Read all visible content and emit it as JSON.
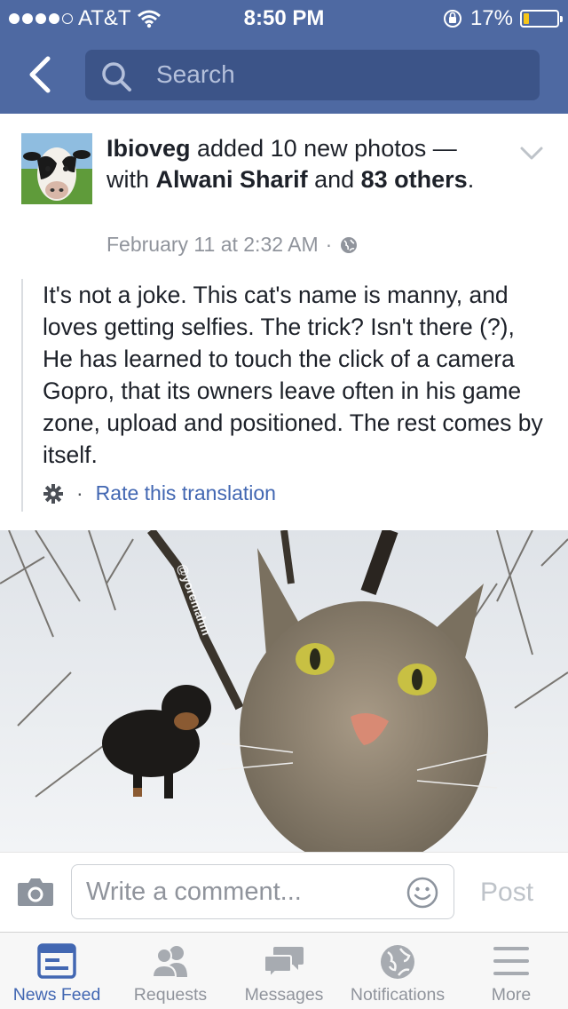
{
  "status_bar": {
    "carrier": "AT&T",
    "time": "8:50 PM",
    "battery": "17%",
    "battery_level": 0.17,
    "signal_bars": 4
  },
  "nav": {
    "search_placeholder": "Search"
  },
  "post": {
    "author": "Ibioveg",
    "action": " added 10 new photos — with ",
    "tagged": "Alwani Sharif",
    "and": " and ",
    "others": "83 others",
    "period": ".",
    "timestamp": "February 11 at 2:32 AM",
    "separator": "·",
    "privacy_icon": "globe-icon",
    "body": "It's not a joke. This cat's name is manny, and loves getting selfies. The trick? Isn't there (?), He has learned to touch the click of a camera Gopro, that its owners leave often in his game zone, upload and positioned. The rest comes by itself.",
    "rate_translation": "Rate this translation",
    "photo_watermark": "@yoremahm"
  },
  "comment_bar": {
    "placeholder": "Write a comment...",
    "post_label": "Post"
  },
  "tabs": [
    {
      "label": "News Feed",
      "icon": "news-feed-icon",
      "active": true
    },
    {
      "label": "Requests",
      "icon": "friend-requests-icon",
      "active": false
    },
    {
      "label": "Messages",
      "icon": "messages-icon",
      "active": false
    },
    {
      "label": "Notifications",
      "icon": "globe-icon",
      "active": false
    },
    {
      "label": "More",
      "icon": "menu-icon",
      "active": false
    }
  ],
  "colors": {
    "brand": "#4e69a2",
    "link": "#4267b2",
    "muted": "#90949c"
  }
}
